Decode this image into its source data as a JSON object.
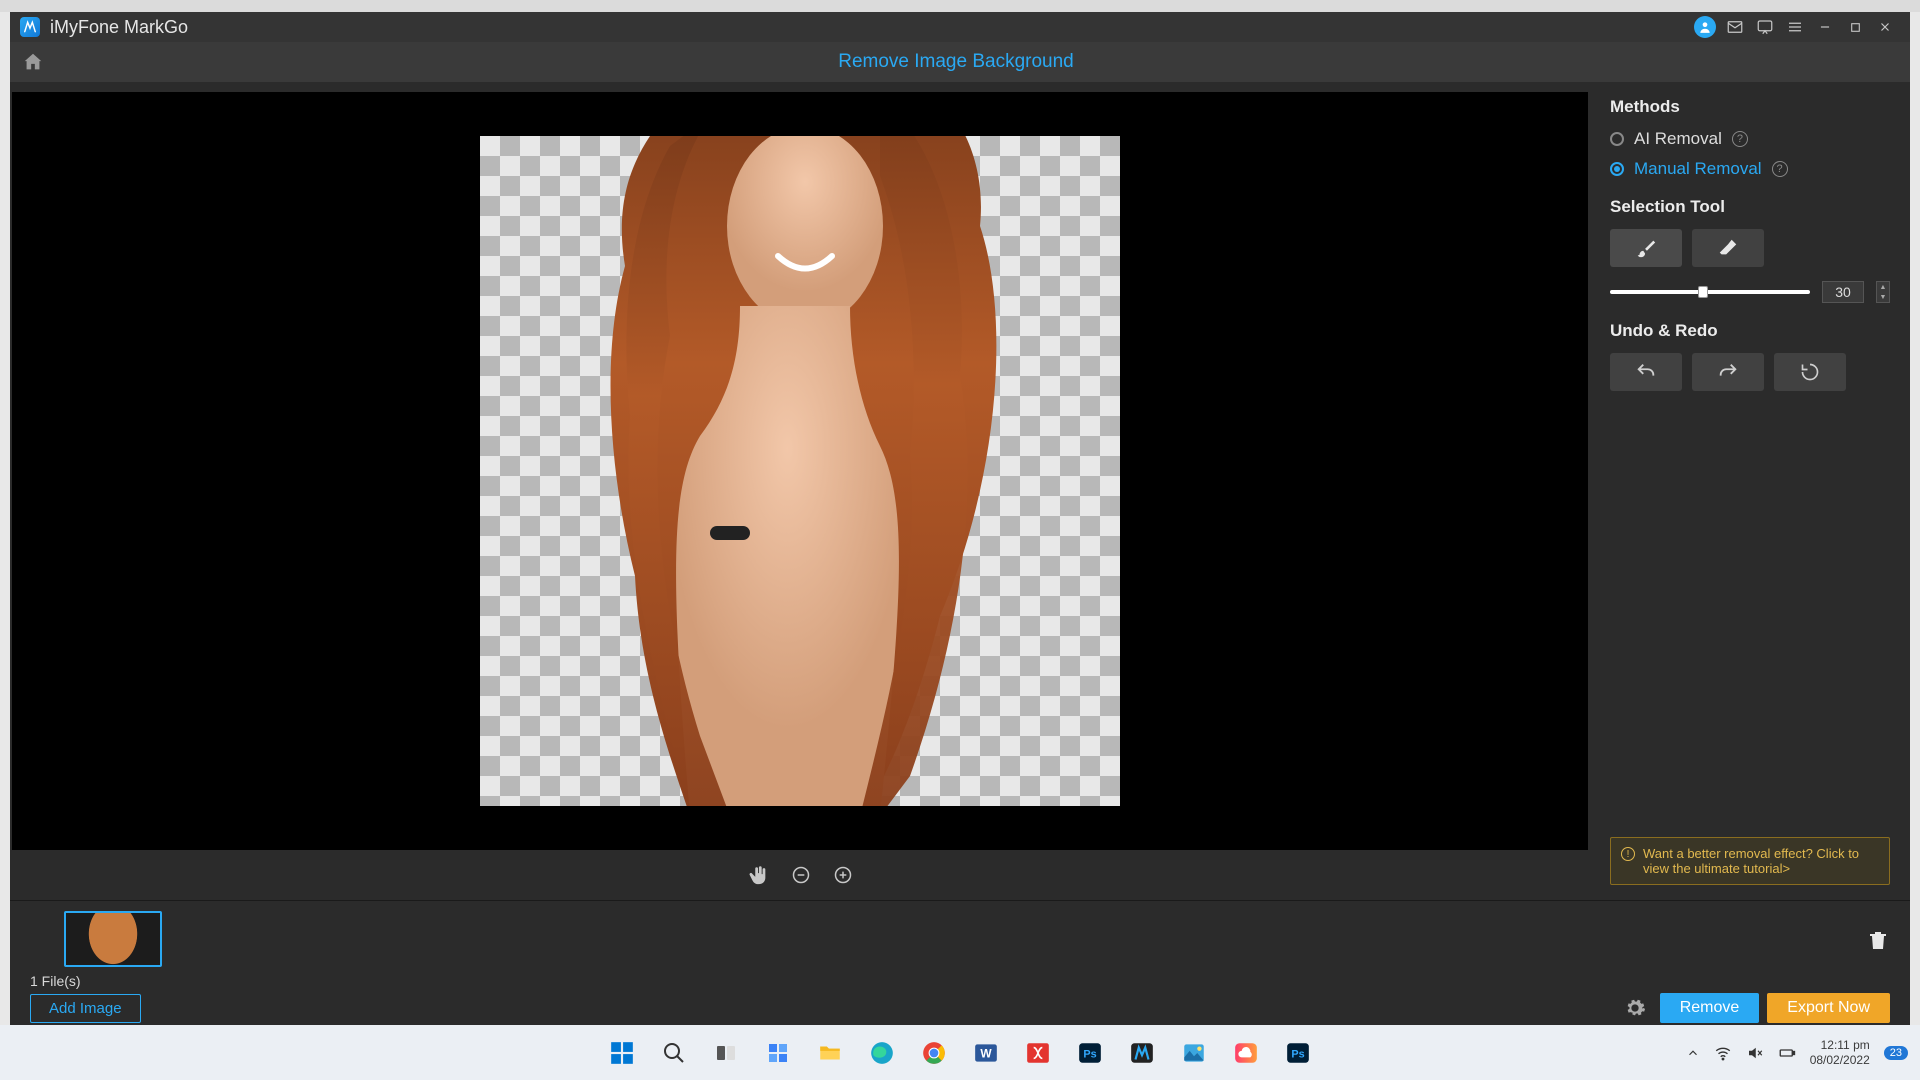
{
  "titlebar": {
    "app_name": "iMyFone MarkGo"
  },
  "header": {
    "title": "Remove Image Background"
  },
  "sidebar": {
    "methods_heading": "Methods",
    "methods": [
      {
        "label": "AI Removal",
        "selected": false
      },
      {
        "label": "Manual Removal",
        "selected": true
      }
    ],
    "selection_heading": "Selection Tool",
    "brush_size": "30",
    "undo_heading": "Undo & Redo",
    "tip_text": "Want a better removal effect? Click to view the ultimate tutorial>"
  },
  "bottom": {
    "file_count": "1 File(s)",
    "add_label": "Add Image",
    "remove_label": "Remove",
    "export_label": "Export Now"
  },
  "taskbar": {
    "time": "12:11 pm",
    "date": "08/02/2022",
    "notif_count": "23"
  },
  "icons": {
    "home": "home-icon",
    "user": "user-icon",
    "mail": "mail-icon",
    "feedback": "feedback-icon",
    "menu": "menu-icon",
    "min": "minimize-icon",
    "max": "maximize-icon",
    "close": "close-icon",
    "hand": "hand-icon",
    "zoom_out": "zoom-out-icon",
    "zoom_in": "zoom-in-icon",
    "brush": "brush-icon",
    "eraser": "eraser-icon",
    "undo": "undo-icon",
    "redo": "redo-icon",
    "reset": "reset-icon",
    "trash": "trash-icon",
    "gear": "gear-icon"
  }
}
